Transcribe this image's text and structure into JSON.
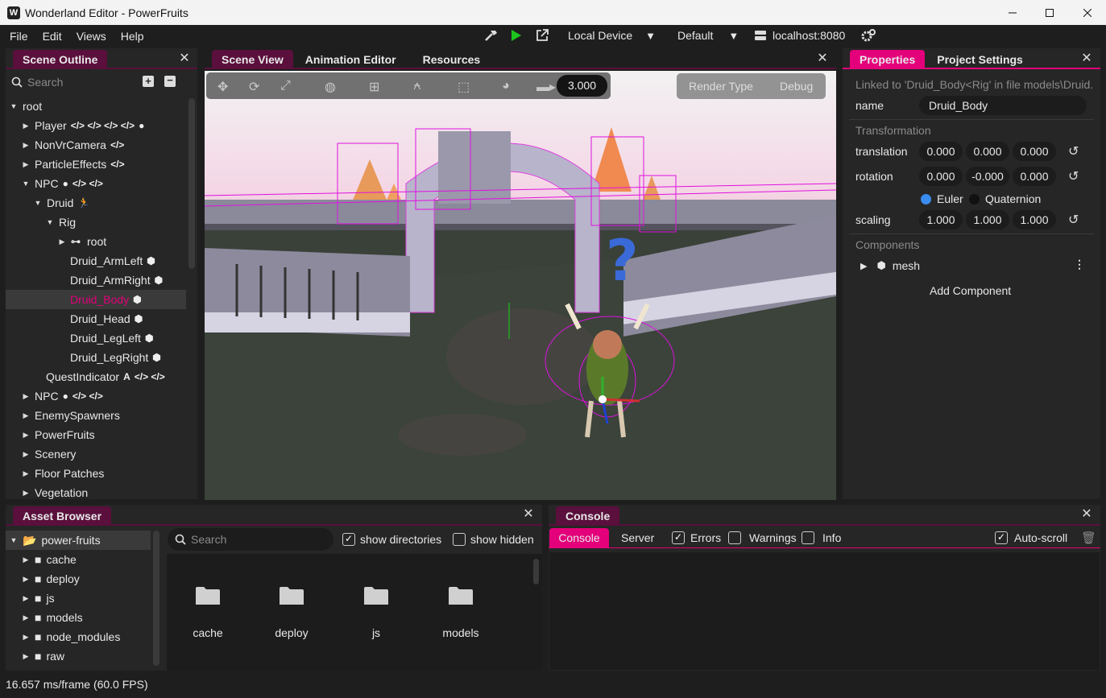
{
  "window": {
    "title": "Wonderland Editor - PowerFruits",
    "logo": "W"
  },
  "menu": [
    "File",
    "Edit",
    "Views",
    "Help"
  ],
  "toolbar": {
    "device": "Local Device",
    "profile": "Default",
    "server": "localhost:8080"
  },
  "scene_outline": {
    "tab": "Scene Outline",
    "search_placeholder": "Search",
    "rows": [
      {
        "label": "root"
      },
      {
        "label": "Player"
      },
      {
        "label": "NonVrCamera"
      },
      {
        "label": "ParticleEffects"
      },
      {
        "label": "NPC"
      },
      {
        "label": "Druid"
      },
      {
        "label": "Rig"
      },
      {
        "label": "root"
      },
      {
        "label": "Druid_ArmLeft"
      },
      {
        "label": "Druid_ArmRight"
      },
      {
        "label": "Druid_Body"
      },
      {
        "label": "Druid_Head"
      },
      {
        "label": "Druid_LegLeft"
      },
      {
        "label": "Druid_LegRight"
      },
      {
        "label": "QuestIndicator"
      },
      {
        "label": "NPC"
      },
      {
        "label": "EnemySpawners"
      },
      {
        "label": "PowerFruits"
      },
      {
        "label": "Scenery"
      },
      {
        "label": "Floor Patches"
      },
      {
        "label": "Vegetation"
      }
    ]
  },
  "center_tabs": [
    "Scene View",
    "Animation Editor",
    "Resources"
  ],
  "viewport": {
    "camera_value": "3.000",
    "render_type": "Render Type",
    "debug": "Debug"
  },
  "properties": {
    "tabs": [
      "Properties",
      "Project Settings"
    ],
    "linked": "Linked to 'Druid_Body<Rig' in file models\\Druid.",
    "name_label": "name",
    "name_value": "Druid_Body",
    "transformation": "Transformation",
    "translation_label": "translation",
    "translation": [
      "0.000",
      "0.000",
      "0.000"
    ],
    "rotation_label": "rotation",
    "rotation": [
      "0.000",
      "-0.000",
      "0.000"
    ],
    "euler": "Euler",
    "quaternion": "Quaternion",
    "scaling_label": "scaling",
    "scaling": [
      "1.000",
      "1.000",
      "1.000"
    ],
    "components": "Components",
    "mesh": "mesh",
    "add_component": "Add Component"
  },
  "asset_browser": {
    "tab": "Asset Browser",
    "tree": [
      "power-fruits",
      "cache",
      "deploy",
      "js",
      "models",
      "node_modules",
      "raw"
    ],
    "search_placeholder": "Search",
    "show_directories": "show directories",
    "show_hidden": "show hidden",
    "items": [
      "cache",
      "deploy",
      "js",
      "models"
    ]
  },
  "console": {
    "tab": "Console",
    "subtabs": [
      "Console",
      "Server"
    ],
    "errors": "Errors",
    "warnings": "Warnings",
    "info": "Info",
    "autoscroll": "Auto-scroll"
  },
  "status": "16.657 ms/frame (60.0 FPS)",
  "colors": {
    "accent": "#e3007a",
    "background": "#1e1e1e",
    "panel": "#262626"
  }
}
